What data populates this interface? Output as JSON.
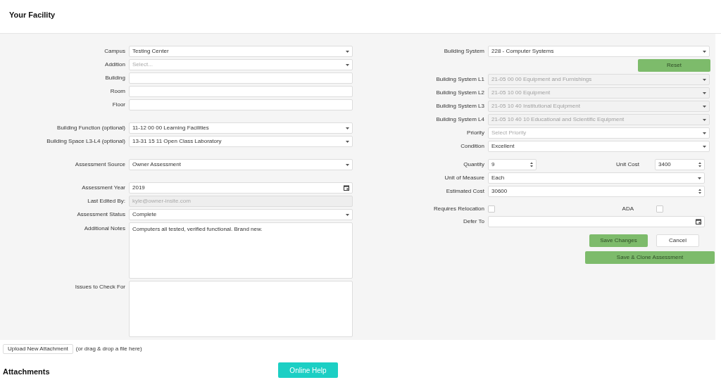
{
  "header": {
    "title": "Your Facility"
  },
  "left": {
    "groups": [
      [
        {
          "kind": "select",
          "label": "Campus",
          "value": "Testing Center",
          "disabled": false
        },
        {
          "kind": "select",
          "label": "Addition",
          "placeholder": "Select...",
          "disabled": false
        },
        {
          "kind": "text",
          "label": "Building"
        },
        {
          "kind": "text",
          "label": "Room"
        },
        {
          "kind": "text",
          "label": "Floor"
        }
      ],
      [
        {
          "kind": "select",
          "label": "Building Function (optional)",
          "value": "11-12 00 00 Learning Facilities",
          "disabled": false
        },
        {
          "kind": "select",
          "label": "Building Space L3-L4 (optional)",
          "value": "13-31 15 11 Open Class Laboratory",
          "disabled": false
        }
      ],
      [
        {
          "kind": "select",
          "label": "Assessment Source",
          "value": "Owner Assessment",
          "disabled": false
        }
      ],
      [
        {
          "kind": "date",
          "label": "Assessment Year",
          "value": "2019"
        },
        {
          "kind": "readonly",
          "label": "Last Edited By:",
          "value": "kyle@owner-insite.com"
        },
        {
          "kind": "select",
          "label": "Assessment Status",
          "value": "Complete",
          "disabled": false
        },
        {
          "kind": "textarea",
          "label": "Additional Notes",
          "value": "Computers all tested, verified functional. Brand new."
        },
        {
          "kind": "textarea",
          "label": "Issues to Check For"
        }
      ]
    ]
  },
  "right": {
    "groups": [
      [
        {
          "kind": "select",
          "label": "Building System",
          "value": "228 - Computer Systems",
          "disabled": false
        },
        {
          "kind": "button",
          "label": "Reset"
        },
        {
          "kind": "select",
          "label": "Building System L1",
          "value": "21-05 00 00 Equipment and Furnishings",
          "disabled": true
        },
        {
          "kind": "select",
          "label": "Building System L2",
          "value": "21-05 10 00 Equipment",
          "disabled": true
        },
        {
          "kind": "select",
          "label": "Building System L3",
          "value": "21-05 10 40 Institutional Equipment",
          "disabled": true
        },
        {
          "kind": "select",
          "label": "Building System L4",
          "value": "21-05 10 40 10 Educational and Scientific Equipment",
          "disabled": true
        },
        {
          "kind": "select",
          "label": "Priority",
          "placeholder": "Select Priority",
          "disabled": false
        },
        {
          "kind": "select",
          "label": "Condition",
          "value": "Excellent",
          "disabled": false
        }
      ],
      [
        {
          "kind": "number_pair",
          "label": "Quantity",
          "value": "9",
          "label_2": "Unit Cost",
          "value_2": "3400"
        },
        {
          "kind": "select",
          "label": "Unit of Measure",
          "value": "Each",
          "disabled": false
        },
        {
          "kind": "number",
          "label": "Estimated Cost",
          "value": "30600"
        }
      ],
      [
        {
          "kind": "checkbox_pair",
          "label": "Requires Relocation",
          "checked": false,
          "label_2": "ADA",
          "checked_2": false
        },
        {
          "kind": "date",
          "label": "Defer To"
        }
      ]
    ],
    "buttons": [
      {
        "label": "Save Changes",
        "kind": "primary"
      },
      {
        "label": "Cancel",
        "kind": "secondary"
      },
      {
        "label": "Save & Clone Assessment",
        "kind": "primary"
      }
    ]
  },
  "upload": {
    "button": "Upload New Attachment",
    "hint": "(or drag & drop a file here)"
  },
  "attachments": {
    "title": "Attachments"
  },
  "help_button": "Online Help"
}
